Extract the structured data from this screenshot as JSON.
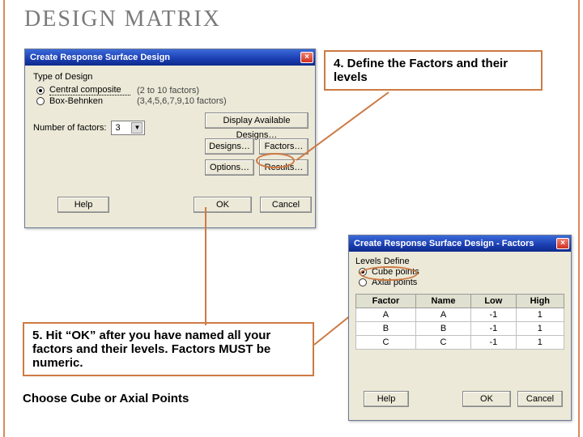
{
  "slide": {
    "title": "DESIGN MATRIX"
  },
  "callouts": {
    "step4": "4.  Define the Factors and their levels",
    "step5": "5. Hit “OK” after you have named all your factors and their levels. Factors MUST be numeric.",
    "note": "Choose Cube or Axial Points"
  },
  "dlg1": {
    "title": "Create Response Surface Design",
    "type_label": "Type of Design",
    "opts": [
      {
        "label": "Central composite",
        "hint": "(2 to 10 factors)",
        "selected": true
      },
      {
        "label": "Box-Behnken",
        "hint": "(3,4,5,6,7,9,10 factors)",
        "selected": false
      }
    ],
    "nf_label": "Number of factors:",
    "nf_value": "3",
    "buttons": {
      "avail": "Display Available Designs…",
      "designs": "Designs…",
      "factors": "Factors…",
      "options": "Options…",
      "results": "Results…",
      "help": "Help",
      "ok": "OK",
      "cancel": "Cancel"
    }
  },
  "dlg2": {
    "title": "Create Response Surface Design - Factors",
    "levels_label": "Levels Define",
    "opts": [
      {
        "label": "Cube points",
        "selected": true
      },
      {
        "label": "Axial points",
        "selected": false
      }
    ],
    "cols": {
      "factor": "Factor",
      "name": "Name",
      "low": "Low",
      "high": "High"
    },
    "rows": [
      {
        "factor": "A",
        "name": "A",
        "low": "-1",
        "high": "1"
      },
      {
        "factor": "B",
        "name": "B",
        "low": "-1",
        "high": "1"
      },
      {
        "factor": "C",
        "name": "C",
        "low": "-1",
        "high": "1"
      }
    ],
    "buttons": {
      "help": "Help",
      "ok": "OK",
      "cancel": "Cancel"
    }
  }
}
